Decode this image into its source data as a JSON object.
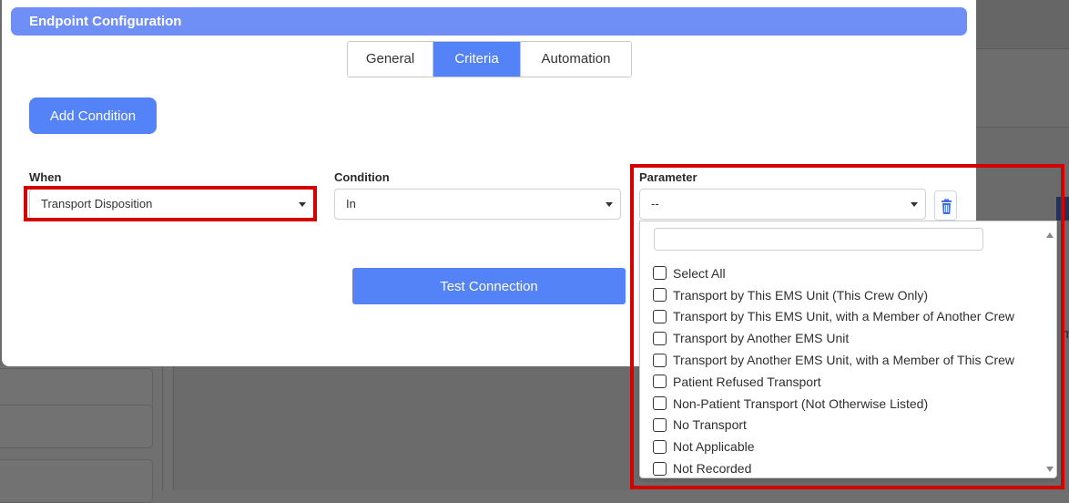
{
  "modal": {
    "title": "Endpoint Configuration",
    "tabs": [
      {
        "label": "General",
        "active": false
      },
      {
        "label": "Criteria",
        "active": true
      },
      {
        "label": "Automation",
        "active": false
      }
    ],
    "add_condition_label": "Add Condition",
    "test_connection_label": "Test Connection"
  },
  "fields": {
    "when": {
      "label": "When",
      "value": "Transport Disposition"
    },
    "condition": {
      "label": "Condition",
      "value": "In"
    },
    "parameter": {
      "label": "Parameter",
      "value": "--"
    }
  },
  "dropdown": {
    "search_placeholder": "",
    "options": [
      "Select All",
      "Transport by This EMS Unit (This Crew Only)",
      "Transport by This EMS Unit, with a Member of Another Crew",
      "Transport by Another EMS Unit",
      "Transport by Another EMS Unit, with a Member of This Crew",
      "Patient Refused Transport",
      "Non-Patient Transport (Not Otherwise Listed)",
      "No Transport",
      "Not Applicable",
      "Not Recorded"
    ]
  },
  "background": {
    "right_fragment": "m"
  },
  "colors": {
    "accent": "#5383f6",
    "header": "#6f8ff7",
    "highlight": "#d40000",
    "trash_icon": "#3d6ee0"
  },
  "icons": {
    "trash": "trash-icon",
    "caret": "caret-down-icon"
  }
}
